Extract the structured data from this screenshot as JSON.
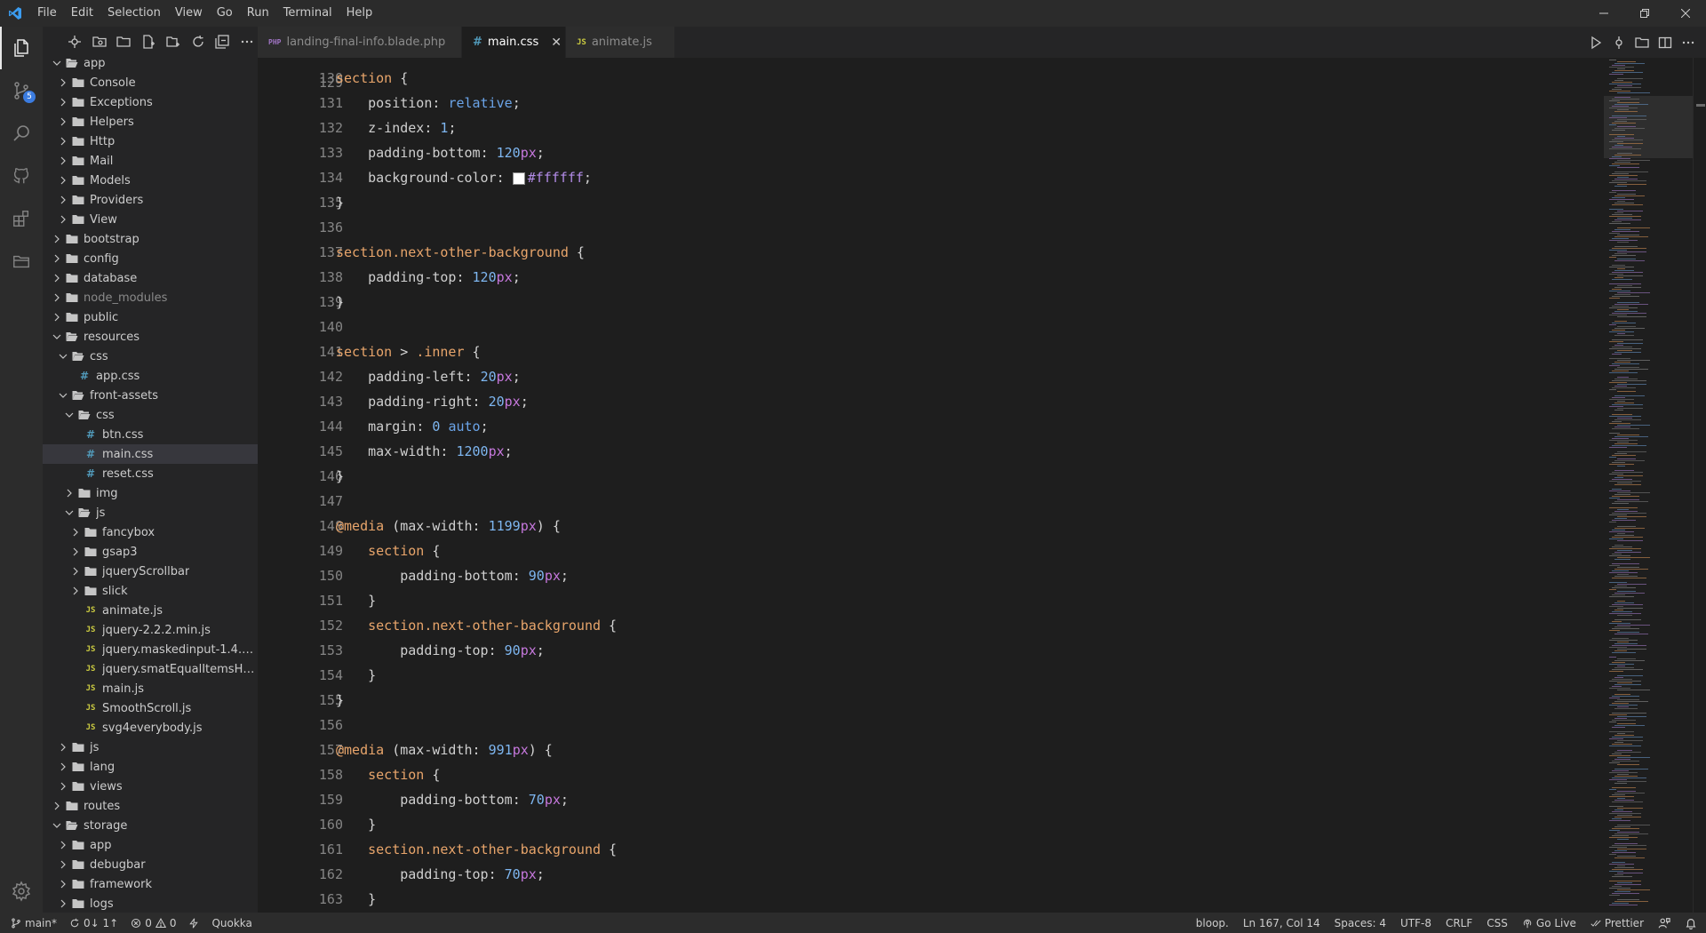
{
  "menu": [
    "File",
    "Edit",
    "Selection",
    "View",
    "Go",
    "Run",
    "Terminal",
    "Help"
  ],
  "activity": {
    "source_control_badge": "5"
  },
  "explorer": {
    "items": [
      {
        "label": "app",
        "depth": 1,
        "type": "folder",
        "open": true
      },
      {
        "label": "Console",
        "depth": 2,
        "type": "folder",
        "open": false
      },
      {
        "label": "Exceptions",
        "depth": 2,
        "type": "folder",
        "open": false
      },
      {
        "label": "Helpers",
        "depth": 2,
        "type": "folder",
        "open": false
      },
      {
        "label": "Http",
        "depth": 2,
        "type": "folder",
        "open": false
      },
      {
        "label": "Mail",
        "depth": 2,
        "type": "folder",
        "open": false
      },
      {
        "label": "Models",
        "depth": 2,
        "type": "folder",
        "open": false
      },
      {
        "label": "Providers",
        "depth": 2,
        "type": "folder",
        "open": false
      },
      {
        "label": "View",
        "depth": 2,
        "type": "folder",
        "open": false
      },
      {
        "label": "bootstrap",
        "depth": 1,
        "type": "folder",
        "open": false
      },
      {
        "label": "config",
        "depth": 1,
        "type": "folder",
        "open": false
      },
      {
        "label": "database",
        "depth": 1,
        "type": "folder",
        "open": false
      },
      {
        "label": "node_modules",
        "depth": 1,
        "type": "folder",
        "open": false,
        "dim": true
      },
      {
        "label": "public",
        "depth": 1,
        "type": "folder",
        "open": false
      },
      {
        "label": "resources",
        "depth": 1,
        "type": "folder",
        "open": true
      },
      {
        "label": "css",
        "depth": 2,
        "type": "folder",
        "open": true
      },
      {
        "label": "app.css",
        "depth": 3,
        "type": "css"
      },
      {
        "label": "front-assets",
        "depth": 2,
        "type": "folder",
        "open": true
      },
      {
        "label": "css",
        "depth": 3,
        "type": "folder",
        "open": true
      },
      {
        "label": "btn.css",
        "depth": 4,
        "type": "css"
      },
      {
        "label": "main.css",
        "depth": 4,
        "type": "css",
        "selected": true
      },
      {
        "label": "reset.css",
        "depth": 4,
        "type": "css"
      },
      {
        "label": "img",
        "depth": 3,
        "type": "folder",
        "open": false
      },
      {
        "label": "js",
        "depth": 3,
        "type": "folder",
        "open": true
      },
      {
        "label": "fancybox",
        "depth": 4,
        "type": "folder",
        "open": false
      },
      {
        "label": "gsap3",
        "depth": 4,
        "type": "folder",
        "open": false
      },
      {
        "label": "jqueryScrollbar",
        "depth": 4,
        "type": "folder",
        "open": false
      },
      {
        "label": "slick",
        "depth": 4,
        "type": "folder",
        "open": false
      },
      {
        "label": "animate.js",
        "depth": 4,
        "type": "js"
      },
      {
        "label": "jquery-2.2.2.min.js",
        "depth": 4,
        "type": "js"
      },
      {
        "label": "jquery.maskedinput-1.4.1....",
        "depth": 4,
        "type": "js"
      },
      {
        "label": "jquery.smatEqualItemsHei...",
        "depth": 4,
        "type": "js"
      },
      {
        "label": "main.js",
        "depth": 4,
        "type": "js"
      },
      {
        "label": "SmoothScroll.js",
        "depth": 4,
        "type": "js"
      },
      {
        "label": "svg4everybody.js",
        "depth": 4,
        "type": "js"
      },
      {
        "label": "js",
        "depth": 2,
        "type": "folder",
        "open": false
      },
      {
        "label": "lang",
        "depth": 2,
        "type": "folder",
        "open": false
      },
      {
        "label": "views",
        "depth": 2,
        "type": "folder",
        "open": false
      },
      {
        "label": "routes",
        "depth": 1,
        "type": "folder",
        "open": false
      },
      {
        "label": "storage",
        "depth": 1,
        "type": "folder",
        "open": true
      },
      {
        "label": "app",
        "depth": 2,
        "type": "folder",
        "open": false
      },
      {
        "label": "debugbar",
        "depth": 2,
        "type": "folder",
        "open": false
      },
      {
        "label": "framework",
        "depth": 2,
        "type": "folder",
        "open": false
      },
      {
        "label": "logs",
        "depth": 2,
        "type": "folder",
        "open": false
      }
    ]
  },
  "tabs": [
    {
      "label": "landing-final-info.blade.php",
      "icon": "php-icon",
      "active": false
    },
    {
      "label": "main.css",
      "icon": "css-icon",
      "active": true
    },
    {
      "label": "animate.js",
      "icon": "js-icon",
      "active": false
    }
  ],
  "code": {
    "top_partial_line_number": "129",
    "lines": [
      {
        "n": "130",
        "tokens": [
          [
            "sel",
            "section"
          ],
          [
            "punc",
            " {"
          ]
        ]
      },
      {
        "n": "131",
        "tokens": [
          [
            "punc",
            "    "
          ],
          [
            "prop",
            "position"
          ],
          [
            "punc",
            ": "
          ],
          [
            "val",
            "relative"
          ],
          [
            "punc",
            ";"
          ]
        ]
      },
      {
        "n": "132",
        "tokens": [
          [
            "punc",
            "    "
          ],
          [
            "prop",
            "z-index"
          ],
          [
            "punc",
            ": "
          ],
          [
            "num",
            "1"
          ],
          [
            "punc",
            ";"
          ]
        ]
      },
      {
        "n": "133",
        "tokens": [
          [
            "punc",
            "    "
          ],
          [
            "prop",
            "padding-bottom"
          ],
          [
            "punc",
            ": "
          ],
          [
            "num",
            "120"
          ],
          [
            "unit",
            "px"
          ],
          [
            "punc",
            ";"
          ]
        ]
      },
      {
        "n": "134",
        "tokens": [
          [
            "punc",
            "    "
          ],
          [
            "prop",
            "background-color"
          ],
          [
            "punc",
            ": "
          ],
          [
            "swatch",
            ""
          ],
          [
            "hex",
            "#ffffff"
          ],
          [
            "punc",
            ";"
          ]
        ]
      },
      {
        "n": "135",
        "tokens": [
          [
            "punc",
            "}"
          ]
        ]
      },
      {
        "n": "136",
        "tokens": []
      },
      {
        "n": "137",
        "tokens": [
          [
            "sel",
            "section"
          ],
          [
            "cls",
            ".next-other-background"
          ],
          [
            "punc",
            " {"
          ]
        ]
      },
      {
        "n": "138",
        "tokens": [
          [
            "punc",
            "    "
          ],
          [
            "prop",
            "padding-top"
          ],
          [
            "punc",
            ": "
          ],
          [
            "num",
            "120"
          ],
          [
            "unit",
            "px"
          ],
          [
            "punc",
            ";"
          ]
        ]
      },
      {
        "n": "139",
        "tokens": [
          [
            "punc",
            "}"
          ]
        ]
      },
      {
        "n": "140",
        "tokens": []
      },
      {
        "n": "141",
        "tokens": [
          [
            "sel",
            "section"
          ],
          [
            "punc",
            " > "
          ],
          [
            "cls",
            ".inner"
          ],
          [
            "punc",
            " {"
          ]
        ]
      },
      {
        "n": "142",
        "tokens": [
          [
            "punc",
            "    "
          ],
          [
            "prop",
            "padding-left"
          ],
          [
            "punc",
            ": "
          ],
          [
            "num",
            "20"
          ],
          [
            "unit",
            "px"
          ],
          [
            "punc",
            ";"
          ]
        ]
      },
      {
        "n": "143",
        "tokens": [
          [
            "punc",
            "    "
          ],
          [
            "prop",
            "padding-right"
          ],
          [
            "punc",
            ": "
          ],
          [
            "num",
            "20"
          ],
          [
            "unit",
            "px"
          ],
          [
            "punc",
            ";"
          ]
        ]
      },
      {
        "n": "144",
        "tokens": [
          [
            "punc",
            "    "
          ],
          [
            "prop",
            "margin"
          ],
          [
            "punc",
            ": "
          ],
          [
            "num",
            "0"
          ],
          [
            "punc",
            " "
          ],
          [
            "val",
            "auto"
          ],
          [
            "punc",
            ";"
          ]
        ]
      },
      {
        "n": "145",
        "tokens": [
          [
            "punc",
            "    "
          ],
          [
            "prop",
            "max-width"
          ],
          [
            "punc",
            ": "
          ],
          [
            "num",
            "1200"
          ],
          [
            "unit",
            "px"
          ],
          [
            "punc",
            ";"
          ]
        ]
      },
      {
        "n": "146",
        "tokens": [
          [
            "punc",
            "}"
          ]
        ]
      },
      {
        "n": "147",
        "tokens": []
      },
      {
        "n": "148",
        "tokens": [
          [
            "at",
            "@media"
          ],
          [
            "punc",
            " ("
          ],
          [
            "prop",
            "max-width"
          ],
          [
            "punc",
            ": "
          ],
          [
            "num",
            "1199"
          ],
          [
            "unit",
            "px"
          ],
          [
            "punc",
            ") {"
          ]
        ]
      },
      {
        "n": "149",
        "tokens": [
          [
            "punc",
            "    "
          ],
          [
            "sel",
            "section"
          ],
          [
            "punc",
            " {"
          ]
        ]
      },
      {
        "n": "150",
        "tokens": [
          [
            "punc",
            "        "
          ],
          [
            "prop",
            "padding-bottom"
          ],
          [
            "punc",
            ": "
          ],
          [
            "num",
            "90"
          ],
          [
            "unit",
            "px"
          ],
          [
            "punc",
            ";"
          ]
        ]
      },
      {
        "n": "151",
        "tokens": [
          [
            "punc",
            "    }"
          ]
        ]
      },
      {
        "n": "152",
        "tokens": [
          [
            "punc",
            "    "
          ],
          [
            "sel",
            "section"
          ],
          [
            "cls",
            ".next-other-background"
          ],
          [
            "punc",
            " {"
          ]
        ]
      },
      {
        "n": "153",
        "tokens": [
          [
            "punc",
            "        "
          ],
          [
            "prop",
            "padding-top"
          ],
          [
            "punc",
            ": "
          ],
          [
            "num",
            "90"
          ],
          [
            "unit",
            "px"
          ],
          [
            "punc",
            ";"
          ]
        ]
      },
      {
        "n": "154",
        "tokens": [
          [
            "punc",
            "    }"
          ]
        ]
      },
      {
        "n": "155",
        "tokens": [
          [
            "punc",
            "}"
          ]
        ]
      },
      {
        "n": "156",
        "tokens": []
      },
      {
        "n": "157",
        "tokens": [
          [
            "at",
            "@media"
          ],
          [
            "punc",
            " ("
          ],
          [
            "prop",
            "max-width"
          ],
          [
            "punc",
            ": "
          ],
          [
            "num",
            "991"
          ],
          [
            "unit",
            "px"
          ],
          [
            "punc",
            ") {"
          ]
        ]
      },
      {
        "n": "158",
        "tokens": [
          [
            "punc",
            "    "
          ],
          [
            "sel",
            "section"
          ],
          [
            "punc",
            " {"
          ]
        ]
      },
      {
        "n": "159",
        "tokens": [
          [
            "punc",
            "        "
          ],
          [
            "prop",
            "padding-bottom"
          ],
          [
            "punc",
            ": "
          ],
          [
            "num",
            "70"
          ],
          [
            "unit",
            "px"
          ],
          [
            "punc",
            ";"
          ]
        ]
      },
      {
        "n": "160",
        "tokens": [
          [
            "punc",
            "    }"
          ]
        ]
      },
      {
        "n": "161",
        "tokens": [
          [
            "punc",
            "    "
          ],
          [
            "sel",
            "section"
          ],
          [
            "cls",
            ".next-other-background"
          ],
          [
            "punc",
            " {"
          ]
        ]
      },
      {
        "n": "162",
        "tokens": [
          [
            "punc",
            "        "
          ],
          [
            "prop",
            "padding-top"
          ],
          [
            "punc",
            ": "
          ],
          [
            "num",
            "70"
          ],
          [
            "unit",
            "px"
          ],
          [
            "punc",
            ";"
          ]
        ]
      },
      {
        "n": "163",
        "tokens": [
          [
            "punc",
            "    }"
          ]
        ]
      }
    ]
  },
  "status": {
    "branch": "main*",
    "sync": "0↓ 1↑",
    "errors": "0",
    "warnings": "0",
    "quokka": "Quokka",
    "bloop": "bloop.",
    "cursor": "Ln 167, Col 14",
    "spaces": "Spaces: 4",
    "encoding": "UTF-8",
    "eol": "CRLF",
    "language": "CSS",
    "golive": "Go Live",
    "prettier": "Prettier"
  },
  "colors": {
    "accent": "#3b7ce0",
    "selector": "#e8a56b",
    "value": "#6ba4e8",
    "unit": "#c678dd",
    "folder": "#c5c5c5"
  }
}
